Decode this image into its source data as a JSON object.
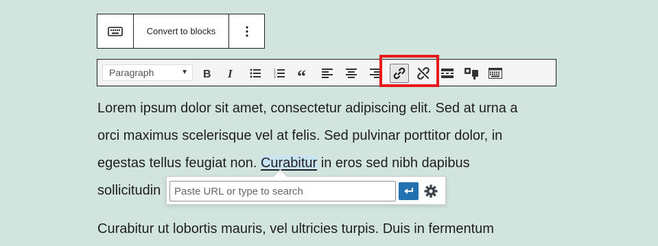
{
  "block_toolbar": {
    "keyboard_icon": "keyboard-icon",
    "convert_label": "Convert to blocks",
    "more_icon": "vertical-ellipsis-icon"
  },
  "classic_toolbar": {
    "format_select_value": "Paragraph",
    "buttons": [
      {
        "icon": "bold-icon"
      },
      {
        "icon": "italic-icon"
      },
      {
        "icon": "bullet-list-icon"
      },
      {
        "icon": "numbered-list-icon"
      },
      {
        "icon": "blockquote-icon"
      },
      {
        "icon": "align-left-icon"
      },
      {
        "icon": "align-center-icon"
      },
      {
        "icon": "align-right-icon"
      },
      {
        "icon": "insert-link-icon",
        "active": true
      },
      {
        "icon": "remove-link-icon"
      },
      {
        "icon": "read-more-icon"
      },
      {
        "icon": "toolbar-toggle-icon"
      },
      {
        "icon": "keyboard-icon"
      }
    ]
  },
  "paragraph1": {
    "line1": "Lorem ipsum dolor sit amet, consectetur adipiscing elit. Sed at urna a",
    "line2": "orci maximus scelerisque vel at felis. Sed pulvinar porttitor dolor, in",
    "line3_before": "egestas tellus feugiat non. ",
    "selected_word": "Curabitur",
    "line3_after": " in eros sed nibh dapibus",
    "line4": "sollicitudin"
  },
  "paragraph2": {
    "line1": "Curabitur ut lobortis mauris, vel ultricies turpis. Duis in fermentum"
  },
  "link_popover": {
    "placeholder": "Paste URL or type to search",
    "submit_icon": "enter-icon",
    "settings_icon": "gear-icon"
  },
  "colors": {
    "background": "#d2e4de",
    "highlight": "#e8181a",
    "submit_button": "#2271b1",
    "selection": "#c8e3f1"
  }
}
